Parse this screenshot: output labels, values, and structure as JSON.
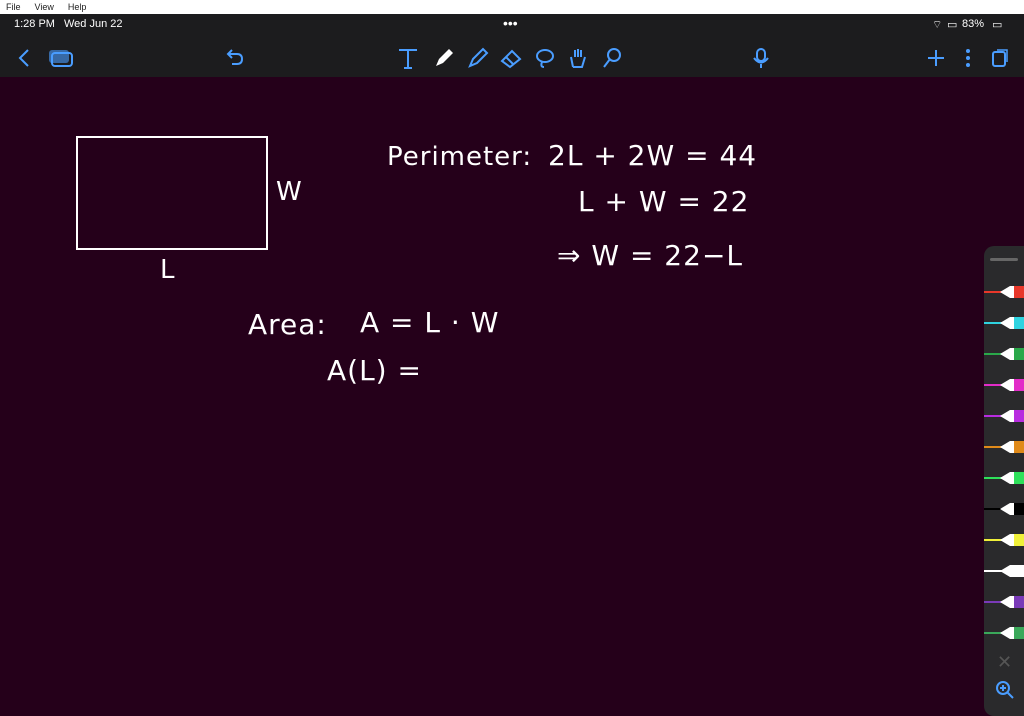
{
  "menu": {
    "file": "File",
    "view": "View",
    "help": "Help"
  },
  "status": {
    "time": "1:28 PM",
    "date": "Wed Jun 22",
    "battery": "83%"
  },
  "toolbar_icons": [
    "back-icon",
    "pages-icon",
    "undo-icon",
    "text-tool-icon",
    "pen-icon",
    "highlighter-icon",
    "eraser-icon",
    "lasso-icon",
    "hand-icon",
    "zoom-tool-icon",
    "mic-icon",
    "add-icon",
    "more-icon",
    "duplicate-icon"
  ],
  "notes": {
    "rect_length_label": "L",
    "rect_width_label": "W",
    "perimeter_label": "Perimeter:",
    "perimeter_eq": "2L + 2W = 44",
    "simplified_eq": "L + W = 22",
    "implies_eq": "⇒ W = 22−L",
    "area_label": "Area:",
    "area_eq": "A = L · W",
    "area_func": "A(L) ="
  },
  "palette_colors": [
    "#e8372a",
    "#2fd3e0",
    "#2aa84a",
    "#e22cc8",
    "#b82ce0",
    "#e08a1a",
    "#2ee05a",
    "#000000",
    "#f0f03a",
    "#ffffff",
    "#7a3ab8",
    "#3aa85a"
  ]
}
